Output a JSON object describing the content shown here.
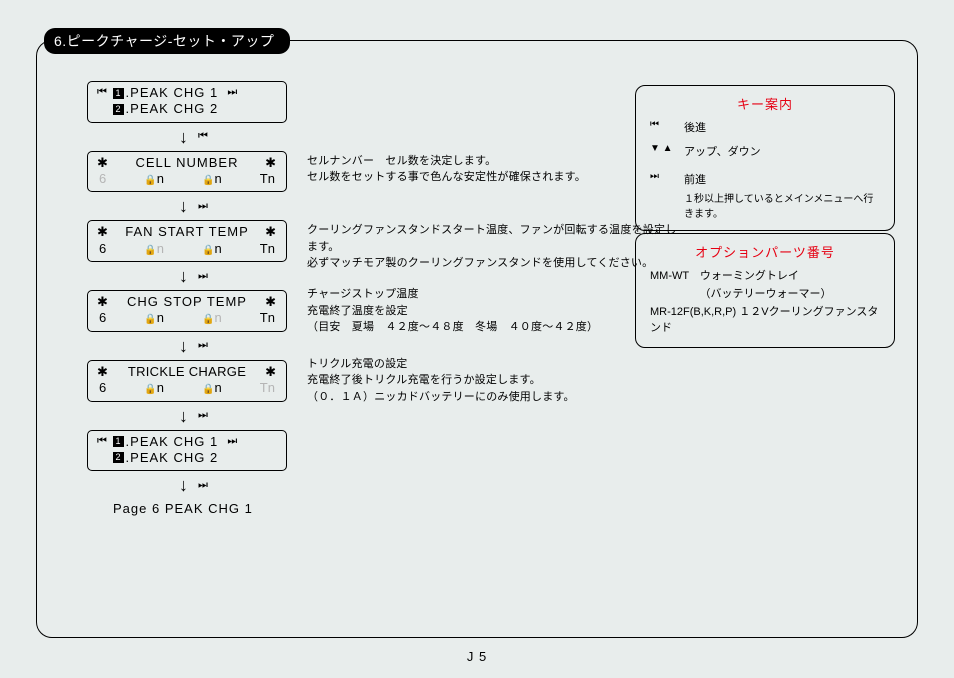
{
  "section_title": "6.ピークチャージ-セット・アップ",
  "steps": [
    {
      "rows": [
        {
          "pre_icon": "⏮",
          "num": "1",
          "text": ".PEAK CHG 1",
          "post_icon": "⏭"
        },
        {
          "pre_icon": "",
          "num": "2",
          "text": ".PEAK CHG 2",
          "post_icon": ""
        }
      ],
      "arrow_glyph": "⏮",
      "desc": ""
    },
    {
      "top": {
        "pre": "✱",
        "title": "CELL NUMBER",
        "post": "✱"
      },
      "bot": {
        "a": "6",
        "a_dim": true,
        "b": "n",
        "c": "n",
        "d": "Tn",
        "d_dim": false
      },
      "arrow_glyph": "⏭",
      "desc": "セルナンバー　セル数を決定します。\nセル数をセットする事で色んな安定性が確保されます。"
    },
    {
      "top": {
        "pre": "✱",
        "title": "FAN START TEMP",
        "post": "✱"
      },
      "bot": {
        "a": "6",
        "a_dim": false,
        "b": "n",
        "b_dim": true,
        "c": "n",
        "d": "Tn"
      },
      "arrow_glyph": "⏭",
      "desc": "クーリングファンスタンドスタート温度、ファンが回転する温度を設定します。\n必ずマッチモア製のクーリングファンスタンドを使用してください。"
    },
    {
      "top": {
        "pre": "✱",
        "title": "CHG STOP TEMP",
        "post": "✱"
      },
      "bot": {
        "a": "6",
        "b": "n",
        "c": "n",
        "c_dim": true,
        "d": "Tn"
      },
      "arrow_glyph": "⏭",
      "desc": "チャージストップ温度\n充電終了温度を設定\n（目安　夏場　４２度～４８度　冬場　４０度～４２度）"
    },
    {
      "top": {
        "pre": "✱",
        "title": "TRICKLE CHARGE",
        "post": "✱"
      },
      "bot": {
        "a": "6",
        "b": "n",
        "c": "n",
        "d": "Tn",
        "d_dim": true
      },
      "arrow_glyph": "⏭",
      "desc": "トリクル充電の設定\n充電終了後トリクル充電を行うか設定します。\n（０．１Ａ）ニッカドバッテリーにのみ使用します。"
    },
    {
      "rows": [
        {
          "pre_icon": "⏮",
          "num": "1",
          "text": ".PEAK CHG 1",
          "post_icon": "⏭"
        },
        {
          "pre_icon": "",
          "num": "2",
          "text": ".PEAK CHG 2",
          "post_icon": ""
        }
      ],
      "arrow_glyph": "⏭",
      "desc": ""
    }
  ],
  "page_label": "Page 6 PEAK CHG 1",
  "key_panel": {
    "title": "キー案内",
    "rows": [
      {
        "icon": "⏮",
        "label": "後進"
      },
      {
        "icon": "▼ ▲",
        "label": "アップ、ダウン"
      },
      {
        "icon": "⏭",
        "label": "前進"
      }
    ],
    "note": "１秒以上押しているとメインメニューへ行きます。"
  },
  "opt_panel": {
    "title": "オプションパーツ番号",
    "lines": [
      "MM-WT　ウォーミングトレイ",
      "　　　　　（バッテリーウォーマー）",
      "MR-12F(B,K,R,P) １２Vクーリングファンスタンド"
    ]
  },
  "footer": "J 5"
}
